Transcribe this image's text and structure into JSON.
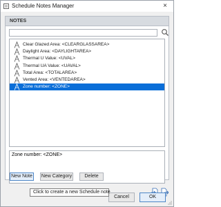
{
  "window": {
    "title": "Schedule Notes Manager",
    "close_glyph": "×"
  },
  "notes_panel": {
    "header": "NOTES",
    "search": {
      "value": "",
      "placeholder": ""
    }
  },
  "notes": [
    {
      "label": "Clear Glazed Area: <CLEARGLASSAREA>",
      "icon": "note-a-icon",
      "selected": false
    },
    {
      "label": "Daylight Area: <DAYLIGHTAREA>",
      "icon": "note-a-icon",
      "selected": false
    },
    {
      "label": "Thermal U Value: <UVAL>",
      "icon": "note-a-icon",
      "selected": false
    },
    {
      "label": "Thermal UA Value: <UAVAL>",
      "icon": "note-a-icon",
      "selected": false
    },
    {
      "label": "Total Area: <TOTALAREA>",
      "icon": "note-a-icon",
      "selected": false
    },
    {
      "label": "Vented Area: <VENTEDAREA>",
      "icon": "note-a-icon",
      "selected": false
    },
    {
      "label": "Zone number: <ZONE>",
      "icon": "note-a-icon",
      "selected": true
    }
  ],
  "editor": {
    "text": "Zone number: <ZONE>"
  },
  "actions": {
    "new_note": "New Note",
    "new_category": "New Category",
    "delete": "Delete"
  },
  "tooltip": "Click to create a new Schedule note",
  "footer": {
    "cancel": "Cancel",
    "ok": "OK"
  },
  "colors": {
    "selection": "#0a6ed8",
    "accent_border": "#4d86c7"
  }
}
